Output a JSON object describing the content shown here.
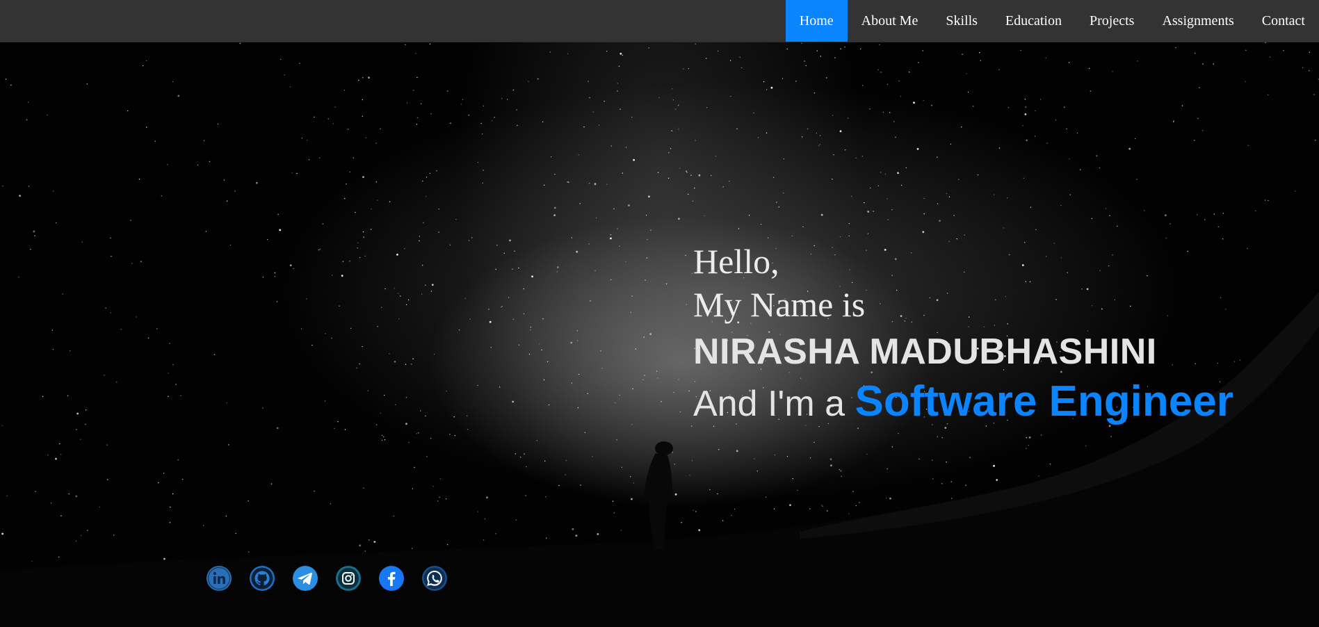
{
  "nav": {
    "items": [
      {
        "label": "Home",
        "active": true
      },
      {
        "label": "About Me",
        "active": false
      },
      {
        "label": "Skills",
        "active": false
      },
      {
        "label": "Education",
        "active": false
      },
      {
        "label": "Projects",
        "active": false
      },
      {
        "label": "Assignments",
        "active": false
      },
      {
        "label": "Contact",
        "active": false
      }
    ]
  },
  "intro": {
    "greeting": "Hello,",
    "name_prefix": "My Name is",
    "name": "NIRASHA MADUBHASHINI",
    "role_prefix": "And I'm a",
    "role": "Software Engineer"
  },
  "socials": [
    {
      "icon": "linkedin-icon",
      "color": "#2b6fb6"
    },
    {
      "icon": "github-icon",
      "color": "#1d72c8"
    },
    {
      "icon": "telegram-icon",
      "color": "#2c8ee0"
    },
    {
      "icon": "instagram-icon",
      "color": "#1a6f8c"
    },
    {
      "icon": "facebook-icon",
      "color": "#1877f2"
    },
    {
      "icon": "whatsapp-icon",
      "color": "#1a4f8a"
    }
  ],
  "colors": {
    "accent": "#0a84ff",
    "navbar": "#333333",
    "text": "#e8e8e8"
  }
}
